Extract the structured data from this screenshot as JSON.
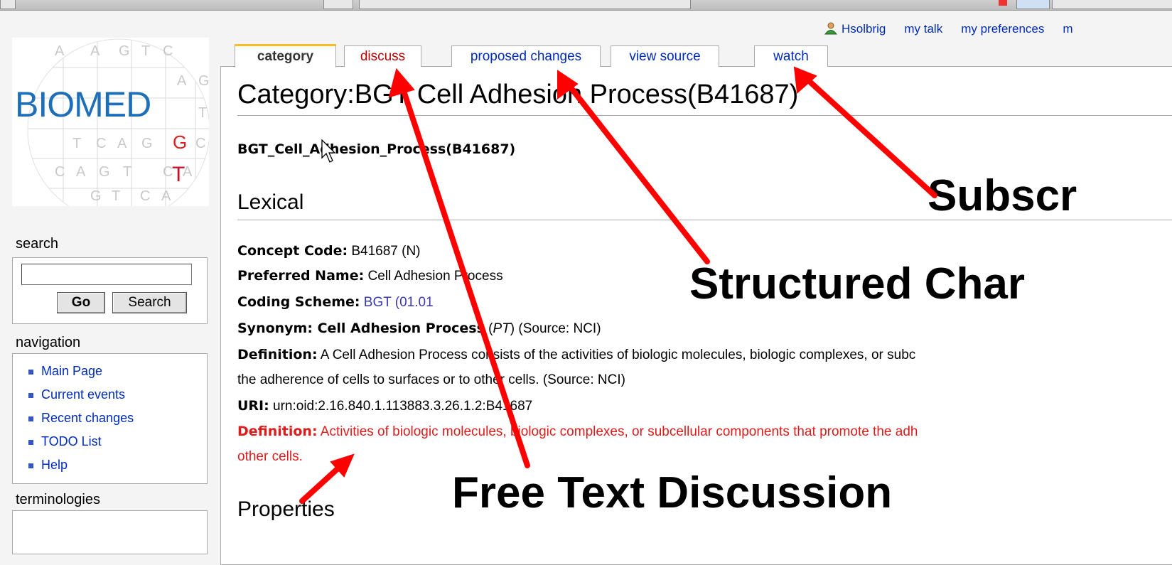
{
  "personal_bar": {
    "username": "Hsolbrig",
    "my_talk": "my talk",
    "my_preferences": "my preferences",
    "my_more": "m"
  },
  "logo": {
    "text": "BIOMED",
    "sub_g": "G",
    "sub_t": "T"
  },
  "sidebar": {
    "search": {
      "title": "search",
      "input_value": "",
      "go_label": "Go",
      "search_label": "Search"
    },
    "navigation": {
      "title": "navigation",
      "items": [
        {
          "label": "Main Page"
        },
        {
          "label": "Current events"
        },
        {
          "label": "Recent changes"
        },
        {
          "label": "TODO List"
        },
        {
          "label": "Help"
        }
      ]
    },
    "terminologies": {
      "title": "terminologies"
    }
  },
  "tabs": [
    {
      "label": "category"
    },
    {
      "label": "discuss"
    },
    {
      "label": "proposed changes"
    },
    {
      "label": "view source"
    },
    {
      "label": "watch"
    }
  ],
  "page": {
    "title": "Category:BGT Cell Adhesion Process(B41687)",
    "concept_heading": "BGT_Cell_Adhesion_Process(B41687)",
    "lexical_heading": "Lexical",
    "concept_code_label": "Concept Code:",
    "concept_code_value": "B41687 (N)",
    "preferred_name_label": "Preferred Name:",
    "preferred_name_value": "Cell Adhesion Process",
    "coding_scheme_label": "Coding Scheme:",
    "coding_scheme_link": "BGT",
    "coding_scheme_version": "(01.01",
    "synonym_label": "Synonym: Cell Adhesion Process",
    "synonym_type": "PT",
    "synonym_source": "(Source: NCI)",
    "definition_label": "Definition:",
    "definition_line1": "A Cell Adhesion Process consists of the activities of biologic molecules, biologic complexes, or subc",
    "definition_line2": "the adherence of cells to surfaces or to other cells. (Source: NCI)",
    "uri_label": "URI:",
    "uri_value": "urn:oid:2.16.840.1.113883.3.26.1.2:B41687",
    "definition2_label": "Definition:",
    "definition2_line1": "Activities of biologic molecules, biologic complexes, or subcellular components that promote the adh",
    "definition2_line2": "other cells.",
    "properties_heading": "Properties"
  },
  "annotations": {
    "subscribe": "Subscr",
    "structured_changes": "Structured Char",
    "free_text_discussion": "Free Text Discussion"
  },
  "colors": {
    "link": "#002bb8",
    "new_link": "#ba0000",
    "selected_tab_top": "#fabd23",
    "arrow": "#ff0000",
    "logo_blue": "#1e6fb7"
  }
}
